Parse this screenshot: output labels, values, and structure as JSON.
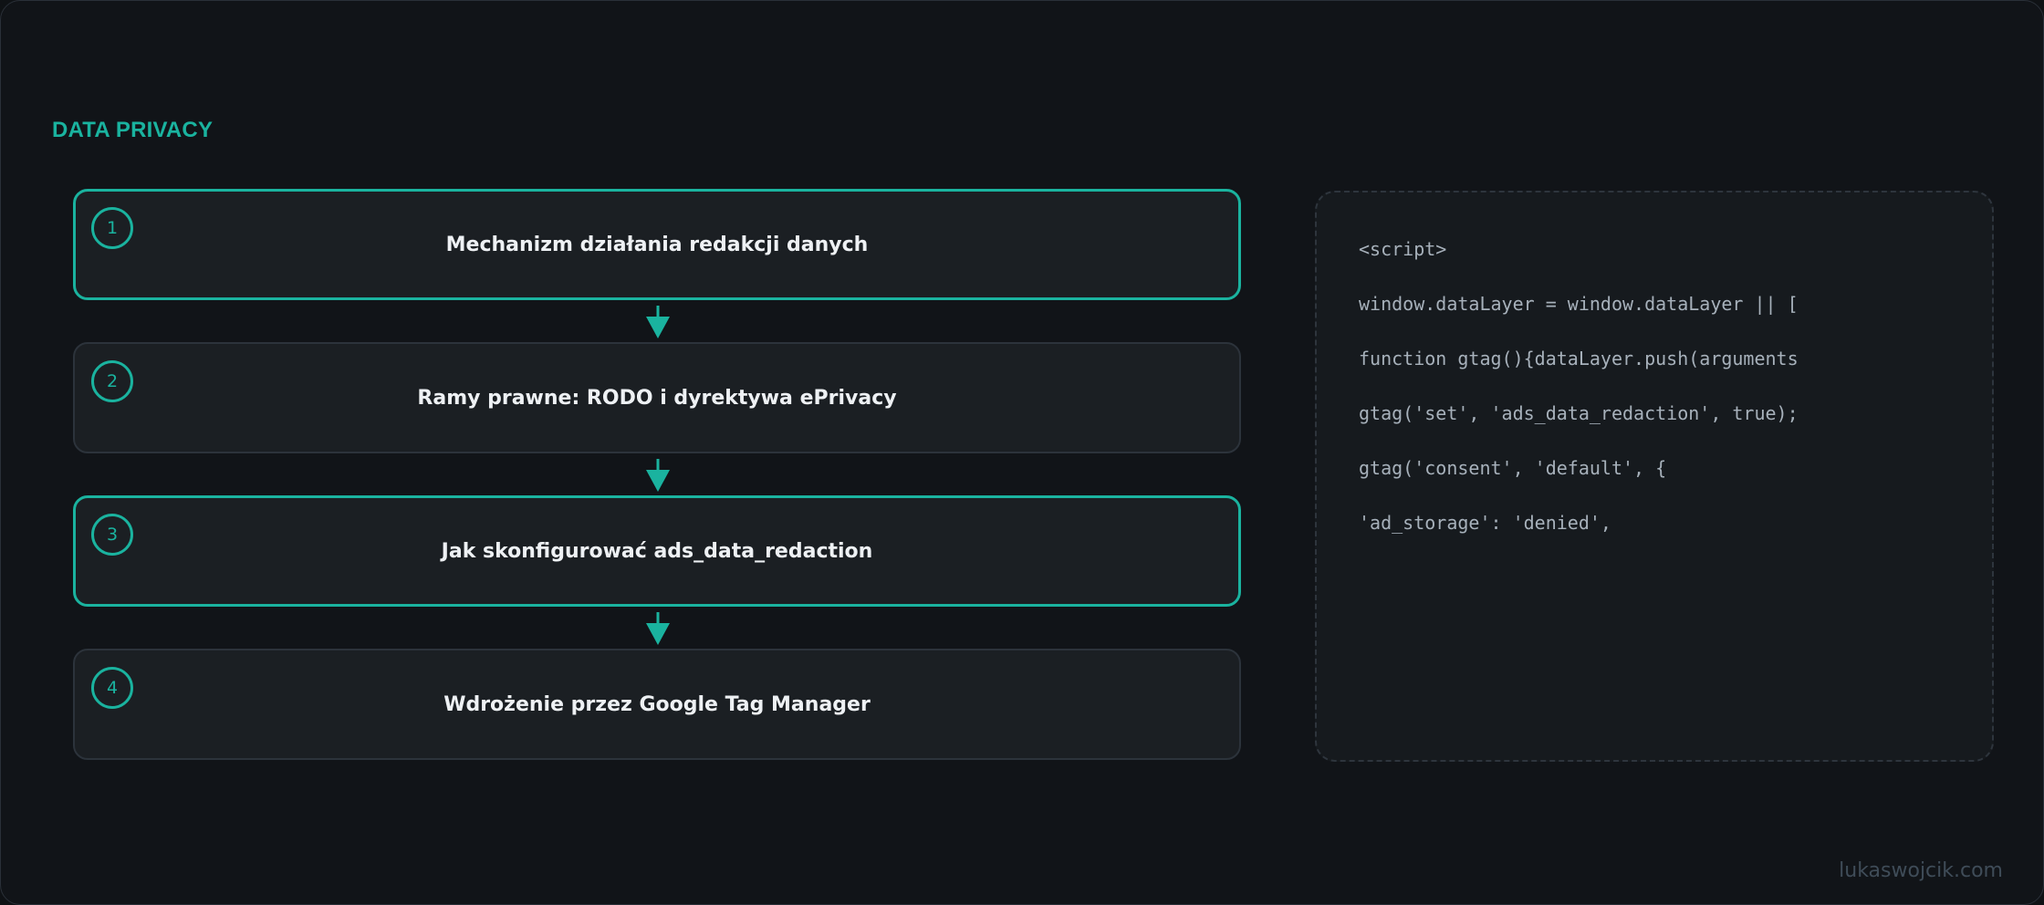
{
  "section_title": "DATA PRIVACY",
  "steps": [
    {
      "number": "1",
      "label": "Mechanizm działania redakcji danych",
      "active": true
    },
    {
      "number": "2",
      "label": "Ramy prawne: RODO i dyrektywa ePrivacy",
      "active": false
    },
    {
      "number": "3",
      "label": "Jak skonfigurować ads_data_redaction",
      "active": true
    },
    {
      "number": "4",
      "label": "Wdrożenie przez Google Tag Manager",
      "active": false
    }
  ],
  "code_lines": [
    "<script>",
    "window.dataLayer = window.dataLayer || [",
    "function gtag(){dataLayer.push(arguments",
    "gtag('set', 'ads_data_redaction', true);",
    "gtag('consent', 'default', {",
    "'ad_storage': 'denied',"
  ],
  "watermark": "lukaswojcik.com",
  "colors": {
    "accent": "#1ab39f",
    "background": "#111418",
    "card": "#1b1f23"
  }
}
